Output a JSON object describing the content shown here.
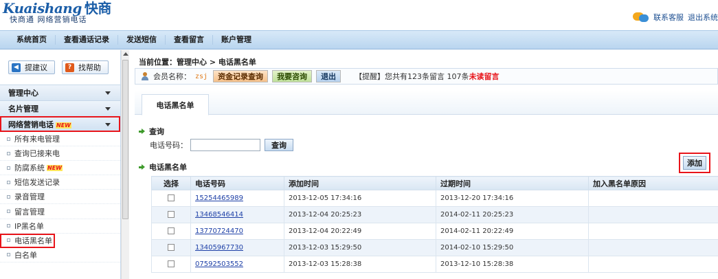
{
  "header": {
    "logo_en": "Kuaishang",
    "logo_cn": "快商",
    "logo_sub": "快商通 网络营销电话",
    "support_link": "联系客服",
    "logout_link": "退出系统"
  },
  "nav": [
    "系统首页",
    "查看通话记录",
    "发送短信",
    "查看留言",
    "账户管理"
  ],
  "sidebar": {
    "buttons": [
      {
        "label": "提建议",
        "icon_glyph": "◀"
      },
      {
        "label": "找帮助",
        "icon_glyph": "?"
      }
    ],
    "sections": [
      {
        "label": "管理中心"
      },
      {
        "label": "名片管理"
      },
      {
        "label": "网络营销电话",
        "badge": "NEW"
      }
    ],
    "items": [
      {
        "label": "所有来电管理"
      },
      {
        "label": "查询已接来电"
      },
      {
        "label": "防腐系统",
        "badge": "NEW"
      },
      {
        "label": "短信发送记录"
      },
      {
        "label": "录音管理"
      },
      {
        "label": "留言管理"
      },
      {
        "label": "IP黑名单"
      },
      {
        "label": "电话黑名单"
      },
      {
        "label": "白名单"
      }
    ]
  },
  "breadcrumb": "当前位置：管理中心 > 电话黑名单",
  "infobar": {
    "member_label": "会员名称：",
    "member_name": "zsj",
    "btn_fund": "资金记录查询",
    "btn_consult": "我要咨询",
    "btn_exit": "退出",
    "reminder_prefix": "【提醒】您共有123条留言  107条",
    "reminder_red": "未读留言"
  },
  "tab": "电话黑名单",
  "search": {
    "title": "查询",
    "label": "电话号码：",
    "value": "",
    "button": "查询"
  },
  "list_title": "电话黑名单",
  "add_button": "添加",
  "table": {
    "headers": [
      "选择",
      "电话号码",
      "添加时间",
      "过期时间",
      "加入黑名单原因"
    ],
    "rows": [
      {
        "phone": "15254465989",
        "added": "2013-12-05 17:34:16",
        "expires": "2013-12-20 17:34:16",
        "reason": ""
      },
      {
        "phone": "13468546414",
        "added": "2013-12-04 20:25:23",
        "expires": "2014-02-11 20:25:23",
        "reason": ""
      },
      {
        "phone": "13770724470",
        "added": "2013-12-04 20:22:49",
        "expires": "2014-02-11 20:22:49",
        "reason": ""
      },
      {
        "phone": "13405967730",
        "added": "2013-12-03 15:29:50",
        "expires": "2014-02-10 15:29:50",
        "reason": ""
      },
      {
        "phone": "07592503552",
        "added": "2013-12-03 15:28:38",
        "expires": "2013-12-10 15:28:38",
        "reason": ""
      }
    ]
  },
  "colors": {
    "accent_blue": "#1b5ea8",
    "highlight_red": "#e8141a",
    "nav_bg": "#c6ddf2"
  }
}
